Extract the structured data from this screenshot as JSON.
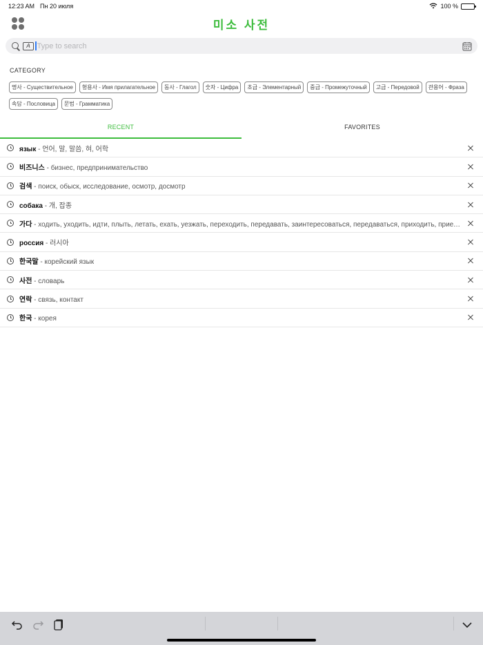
{
  "status_bar": {
    "time": "12:23 AM",
    "date": "Пн 20 июля",
    "battery": "100 %",
    "wifi_icon": "wifi-icon",
    "battery_level": 1.0
  },
  "header": {
    "title": "미소 사전",
    "menu_icon": "grid-dots-icon"
  },
  "search": {
    "placeholder": "Type to search",
    "value": "",
    "handwriting_icon_text": "A"
  },
  "category": {
    "label": "CATEGORY",
    "chips": [
      "명사 - Существительное",
      "형용사 - Имя прилагательное",
      "동사 - Глагол",
      "숫자 - Цифра",
      "초급 - Элементарный",
      "중급 - Промежуточный",
      "고급 - Передовой",
      "관용어 - Фраза",
      "속담 - Пословица",
      "문법 - Грамматика"
    ]
  },
  "tabs": [
    {
      "label": "RECENT",
      "active": true
    },
    {
      "label": "FAVORITES",
      "active": false
    }
  ],
  "recent": [
    {
      "word": "язык",
      "definition": " - 언어, 말, 말씀, 혀, 어학"
    },
    {
      "word": "비즈니스",
      "definition": " - бизнес, предпринимательство"
    },
    {
      "word": "검색",
      "definition": " - поиск, обыск, исследование, осмотр, досмотр"
    },
    {
      "word": "собака",
      "definition": " - 개, 잡종"
    },
    {
      "word": "가다",
      "definition": " - ходить, уходить, идти, плыть, летать, ехать, уезжать, переходить, передавать, заинтересоваться, передаваться, приходить, приезжать"
    },
    {
      "word": "россия",
      "definition": " - 러시아"
    },
    {
      "word": "한국말",
      "definition": " - корейский язык"
    },
    {
      "word": "사전",
      "definition": " - словарь"
    },
    {
      "word": "연락",
      "definition": " - связь, контакт"
    },
    {
      "word": "한국",
      "definition": " - корея"
    }
  ],
  "colors": {
    "accent": "#3cbc3c",
    "toolbar": "#d4d5d9",
    "cursor": "#2f7cf6"
  }
}
